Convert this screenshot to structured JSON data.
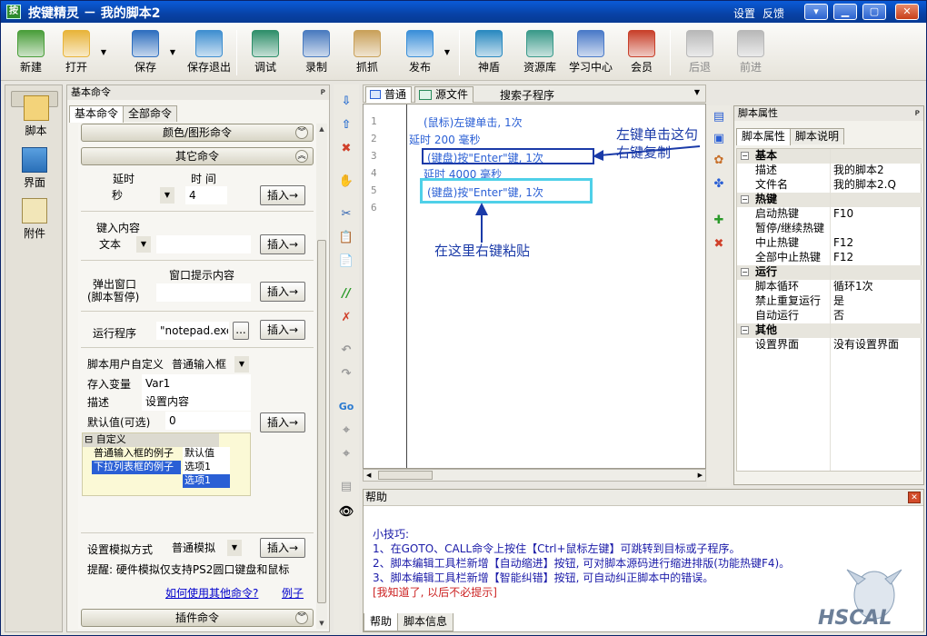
{
  "window": {
    "title": "按键精灵 － 我的脚本2",
    "links": [
      "设置",
      "反馈"
    ],
    "controls": {
      "help": "▾",
      "min": "▁",
      "max": "▢",
      "close": "✕"
    }
  },
  "toolbar": {
    "items": [
      {
        "label": "新建",
        "icon": "new-document-icon",
        "color": "#4a9e3a"
      },
      {
        "label": "打开",
        "icon": "open-folder-icon",
        "color": "#e8b43a"
      },
      {
        "label": "保存",
        "icon": "save-floppy-icon",
        "color": "#2f6fbf"
      },
      {
        "label": "保存退出",
        "icon": "save-exit-icon",
        "color": "#3f8fd0"
      },
      {
        "label": "调试",
        "icon": "debug-icon",
        "color": "#2f8f6a"
      },
      {
        "label": "录制",
        "icon": "record-camera-icon",
        "color": "#4a7bbf"
      },
      {
        "label": "抓抓",
        "icon": "grab-hand-icon",
        "color": "#c9a15a"
      },
      {
        "label": "发布",
        "icon": "publish-globe-icon",
        "color": "#3a8fd8"
      },
      {
        "label": "神盾",
        "icon": "shield-icon",
        "color": "#2a8ac0"
      },
      {
        "label": "资源库",
        "icon": "library-icon",
        "color": "#3a9a8a"
      },
      {
        "label": "学习中心",
        "icon": "learning-center-icon",
        "color": "#4a7ac8"
      },
      {
        "label": "会员",
        "icon": "member-icon",
        "color": "#c8402a"
      },
      {
        "label": "后退",
        "icon": "back-arrow-icon",
        "color": "#b8b8b8"
      },
      {
        "label": "前进",
        "icon": "forward-arrow-icon",
        "color": "#b8b8b8"
      }
    ]
  },
  "leftnav": {
    "items": [
      {
        "label": "脚本",
        "icon": "script-icon"
      },
      {
        "label": "界面",
        "icon": "interface-icon"
      },
      {
        "label": "附件",
        "icon": "attachment-icon"
      }
    ]
  },
  "commands": {
    "header": "基本命令",
    "pin": "ᴘ",
    "tabs": [
      "基本命令",
      "全部命令"
    ],
    "group_color": "颜色/图形命令",
    "group_other": "其它命令",
    "group_plugin": "插件命令",
    "chev_up": "︽",
    "chev_down": "︾",
    "insert": "插入→",
    "delay": {
      "label1": "延时",
      "label2": "时 间",
      "unit": "秒",
      "value": "4"
    },
    "key_input": {
      "label": "键入内容",
      "type": "文本",
      "value": ""
    },
    "popup": {
      "label": "弹出窗口",
      "sub": "(脚本暂停)",
      "label2": "窗口提示内容"
    },
    "run": {
      "label": "运行程序",
      "value": "\"notepad.exe\"",
      "browse": "..."
    },
    "custom": {
      "label": "脚本用户自定义",
      "type": "普通输入框"
    },
    "store": {
      "label": "存入变量",
      "value": "Var1"
    },
    "desc": {
      "label": "描述",
      "value": "设置内容"
    },
    "default": {
      "label": "默认值(可选)",
      "value": "0"
    },
    "grid": {
      "title": "自定义",
      "rows": [
        {
          "name": "普通输入框的例子",
          "value": "默认值"
        },
        {
          "name": "下拉列表框的例子",
          "value": "选项1"
        }
      ],
      "dropdown": "选项1"
    },
    "sim": {
      "label": "设置模拟方式",
      "value": "普通模拟"
    },
    "hint": "提醒: 硬件模拟仅支持PS2圆口键盘和鼠标",
    "link_how": "如何使用其他命令?",
    "link_example": "例子"
  },
  "editor": {
    "tab_normal": "普通",
    "tab_source": "源文件",
    "search_sub": "搜索子程序",
    "lines": [
      {
        "n": "1",
        "text": "(鼠标)左键单击, 1次"
      },
      {
        "n": "2",
        "text": "延时 200 毫秒"
      },
      {
        "n": "3",
        "text": "(键盘)按\"Enter\"键, 1次"
      },
      {
        "n": "4",
        "text": "延时 4000 毫秒"
      },
      {
        "n": "5",
        "text": "(键盘)按\"Enter\"键, 1次"
      },
      {
        "n": "6",
        "text": ""
      }
    ],
    "annotation_copy_1": "左键单击这句",
    "annotation_copy_2": "右键复制",
    "annotation_paste": "在这里右键粘贴",
    "colors": {
      "code": "#2a5fd5",
      "annot": "#1a3aa8",
      "box_copy": "#1a3aa8",
      "box_paste": "#4fd0e8"
    }
  },
  "vtools": [
    "⇩",
    "⇧",
    "✖",
    "✋",
    "✂",
    "📋",
    "📄",
    "//",
    "✗",
    "↶",
    "↷",
    "Go",
    "⌖",
    "⌖",
    "▤",
    "👁"
  ],
  "properties": {
    "header": "脚本属性",
    "tabs": [
      "脚本属性",
      "脚本说明"
    ],
    "rows": [
      {
        "cat": true,
        "k": "基本"
      },
      {
        "k": "描述",
        "v": "我的脚本2"
      },
      {
        "k": "文件名",
        "v": "我的脚本2.Q"
      },
      {
        "cat": true,
        "k": "热键"
      },
      {
        "k": "启动热键",
        "v": "F10"
      },
      {
        "k": "暂停/继续热键",
        "v": ""
      },
      {
        "k": "中止热键",
        "v": "F12"
      },
      {
        "k": "全部中止热键",
        "v": "F12"
      },
      {
        "cat": true,
        "k": "运行"
      },
      {
        "k": "脚本循环",
        "v": "循环1次"
      },
      {
        "k": "禁止重复运行",
        "v": "是"
      },
      {
        "k": "自动运行",
        "v": "否"
      },
      {
        "cat": true,
        "k": "其他"
      },
      {
        "k": "设置界面",
        "v": "没有设置界面"
      }
    ]
  },
  "help": {
    "header": "帮助",
    "title": "小技巧:",
    "tip1": "1、在GOTO、CALL命令上按住【Ctrl+鼠标左键】可跳转到目标或子程序。",
    "tip2": "2、脚本编辑工具栏新增【自动缩进】按钮, 可对脚本源码进行缩进排版(功能热键F4)。",
    "tip3": "3、脚本编辑工具栏新增【智能纠错】按钮, 可自动纠正脚本中的错误。",
    "dismiss": "[我知道了, 以后不必提示]",
    "tabs": [
      "帮助",
      "脚本信息"
    ],
    "logo": "HSCAL"
  }
}
